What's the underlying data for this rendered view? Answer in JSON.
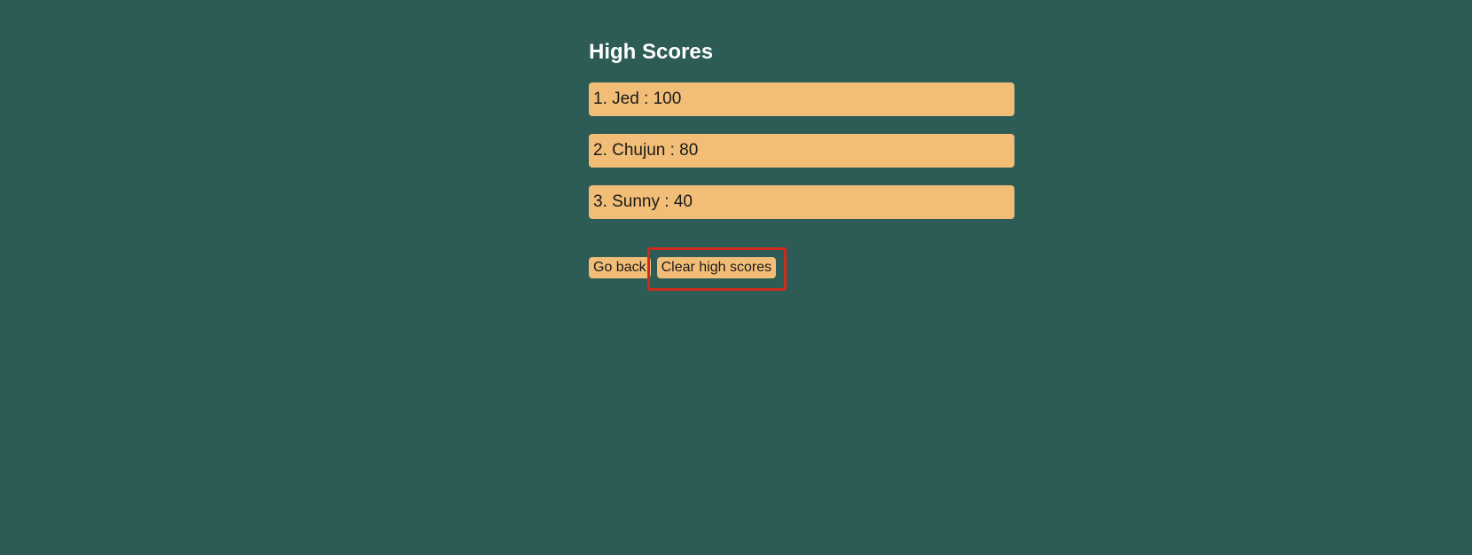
{
  "page": {
    "title": "High Scores"
  },
  "scores": [
    {
      "label": "1. Jed : 100"
    },
    {
      "label": "2. Chujun : 80"
    },
    {
      "label": "3. Sunny : 40"
    }
  ],
  "buttons": {
    "go_back": "Go back",
    "clear": "Clear high scores"
  },
  "colors": {
    "background": "#2d5b55",
    "item_background": "#f2be77",
    "highlight": "#d02a1c"
  }
}
